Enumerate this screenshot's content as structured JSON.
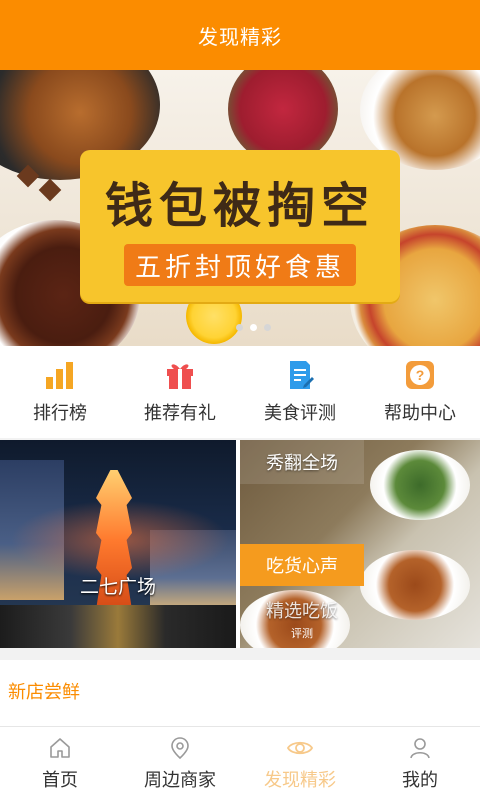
{
  "header": {
    "title": "发现精彩"
  },
  "banner": {
    "headline": "钱包被掏空",
    "subline": "五折封顶好食惠",
    "slide_count": 3,
    "active_slide": 2
  },
  "quick_menu": [
    {
      "label": "排行榜",
      "icon": "bar-chart-icon",
      "color": "#f5a623"
    },
    {
      "label": "推荐有礼",
      "icon": "gift-icon",
      "color": "#ef4f4f"
    },
    {
      "label": "美食评测",
      "icon": "edit-document-icon",
      "color": "#2e9bea"
    },
    {
      "label": "帮助中心",
      "icon": "question-icon",
      "color": "#f39c3b"
    }
  ],
  "feature_tiles": {
    "left_caption": "二七广场",
    "right_tags": {
      "top": "秀翻全场",
      "middle": "吃货心声",
      "bottom_main": "精选吃饭",
      "bottom_small": "评测"
    }
  },
  "section": {
    "title": "新店尝鲜"
  },
  "tabbar": [
    {
      "label": "首页",
      "icon": "home-icon",
      "active": false
    },
    {
      "label": "周边商家",
      "icon": "location-pin-icon",
      "active": false
    },
    {
      "label": "发现精彩",
      "icon": "eye-icon",
      "active": true
    },
    {
      "label": "我的",
      "icon": "user-icon",
      "active": false
    }
  ],
  "colors": {
    "accent": "#fb8c00",
    "active_tab": "#f7c98a"
  }
}
